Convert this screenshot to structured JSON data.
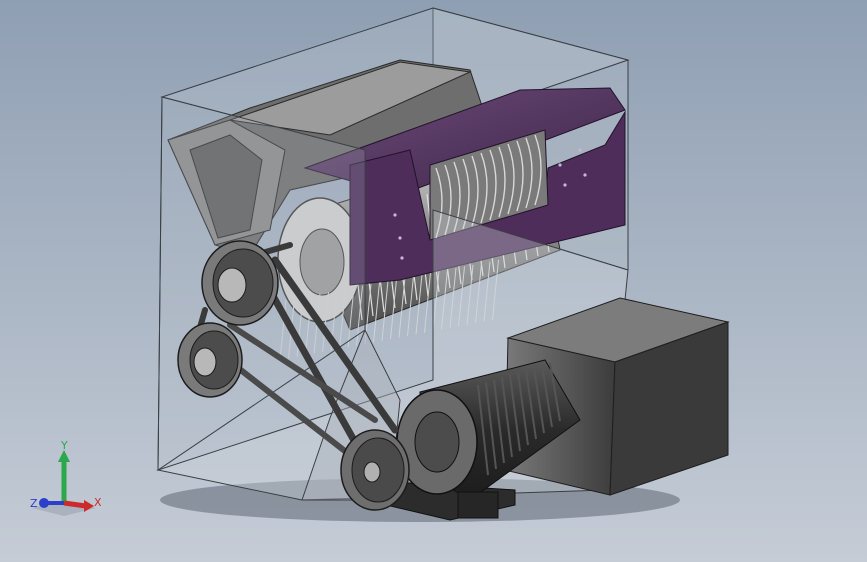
{
  "viewport": {
    "background_top": "#8f9fb3",
    "background_bottom": "#c5ccd6"
  },
  "model": {
    "housing_color": "#b8c0c8",
    "housing_edge_color": "#3a3f45",
    "guard_color": "#5a3a66",
    "motor_color": "#3a3a3a",
    "gearbox_color": "#4a4a4a",
    "pulley_color": "#6e6e6e"
  },
  "triad": {
    "x_label": "X",
    "y_label": "Y",
    "z_label": "Z",
    "x_color": "#cc2b2b",
    "y_color": "#2aa84a",
    "z_color": "#2b3fcc"
  }
}
